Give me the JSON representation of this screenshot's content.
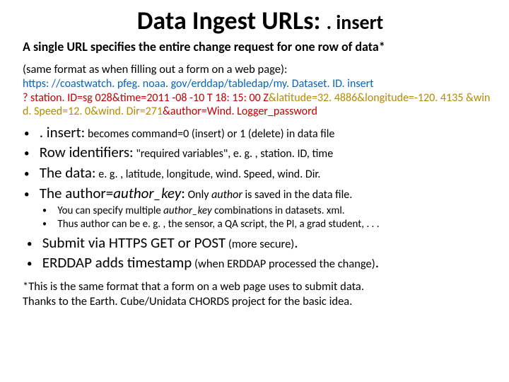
{
  "title": {
    "main": "Data Ingest URLs:",
    "suffix": ". insert"
  },
  "subhead": "A single URL specifies the entire change request for one row of data*",
  "lead": "(same format as when filling out a form on a web page):",
  "url": {
    "base": "https: //coastwatch. pfeg. noaa. gov/erddap/tabledap/my. Dataset. ID. insert",
    "row": "? station. ID=sg 028&time=2011 -08 -10 T 18: 15: 00 Z",
    "data": "&latitude=32. 4886&longitude=-120. 4135 &wind. Speed=12. 0&wind. Dir=271",
    "auth": "&author=Wind. Logger_password"
  },
  "bullets": [
    {
      "term": ". insert:",
      "desc": "becomes command=0 (insert) or 1 (delete) in data file"
    },
    {
      "term": "Row identifiers:",
      "desc": "\"required variables\", e. g. , station. ID, time"
    },
    {
      "term": "The data:",
      "desc": "e. g. , latitude, longitude, wind. Speed, wind. Dir."
    },
    {
      "term_pre": "The author=",
      "term_ital": "author_key",
      "term_post": ":",
      "desc_pre": "Only ",
      "desc_ital": "author",
      "desc_post": " is saved in the data file."
    }
  ],
  "sub_bullets": [
    {
      "pre": "You can specify multiple ",
      "ital": "author_key",
      "post": " combinations in datasets. xml."
    },
    {
      "text": "Thus author can be e. g. , the sensor, a QA script, the PI, a grad student, . . ."
    }
  ],
  "lower_bullets": [
    {
      "term": "Submit via HTTPS GET or POST",
      "desc": "(more secure)"
    },
    {
      "term": "ERDDAP adds timestamp",
      "desc": "(when ERDDAP processed the change)"
    }
  ],
  "foot1": "*This is the same format that a form on a web page uses to submit data.",
  "foot2": "Thanks to the Earth. Cube/Unidata CHORDS project for the basic idea."
}
